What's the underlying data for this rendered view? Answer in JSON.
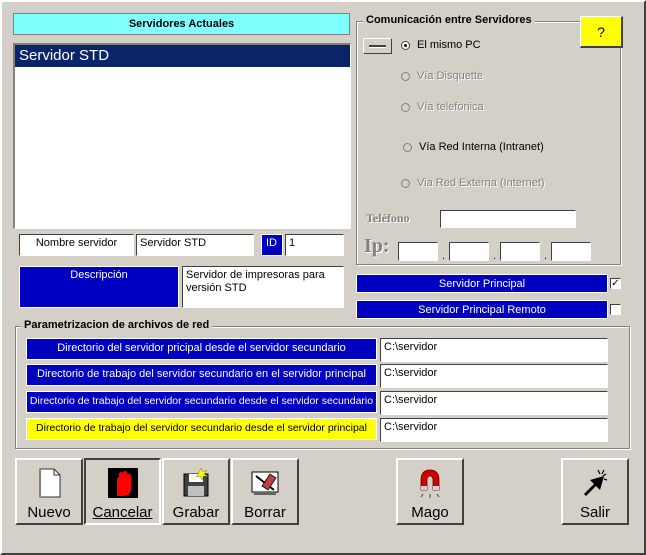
{
  "servers_panel": {
    "header": "Servidores Actuales",
    "items": [
      "Servidor STD"
    ]
  },
  "server_fields": {
    "name_label": "Nombre servidor",
    "name_value": "Servidor STD",
    "id_label": "ID",
    "id_value": "1",
    "desc_label": "Descripción",
    "desc_value": "Servidor de impresoras para versión STD"
  },
  "comms": {
    "title": "Comunicación entre Servidores",
    "help_label": "?",
    "options": [
      {
        "label": "El mismo PC",
        "selected": true,
        "enabled": true
      },
      {
        "label": "Vía Disquette",
        "selected": false,
        "enabled": false
      },
      {
        "label": "Vía telefonica",
        "selected": false,
        "enabled": false
      },
      {
        "label": "Vía Red Interna (Intranet)",
        "selected": false,
        "enabled": true
      },
      {
        "label": "Via Red Externa (Internet)",
        "selected": false,
        "enabled": false
      }
    ],
    "phone_label": "Teléfono",
    "phone_value": "",
    "ip_label": "Ip:",
    "ip_sep": ".",
    "ip_parts": [
      "",
      "",
      "",
      ""
    ]
  },
  "server_flags": {
    "principal_label": "Servidor Principal",
    "principal_checked": true,
    "remote_label": "Servidor Principal Remoto",
    "remote_checked": false
  },
  "network_params": {
    "title": "Parametrizacion de archivos de red",
    "rows": [
      {
        "label": "Directorio del servidor pricipal desde el servidor secundario",
        "value": "C:\\servidor",
        "highlight": false
      },
      {
        "label": "Directorio de trabajo del servidor secundario en el servidor principal",
        "value": "C:\\servidor",
        "highlight": false
      },
      {
        "label": "Directorio de trabajo del servidor secundario desde el servidor secundario",
        "value": "C:\\servidor",
        "highlight": false
      },
      {
        "label": "Directorio de trabajo del servidor secundario desde el servidor principal",
        "value": "C:\\servidor",
        "highlight": true
      }
    ]
  },
  "toolbar": {
    "nuevo": "Nuevo",
    "cancelar": "Cancelar",
    "grabar": "Grabar",
    "borrar": "Borrar",
    "mago": "Mago",
    "salir": "Salir"
  },
  "colors": {
    "window_bg": "#d4d0c8",
    "header_cyan": "#80ffff",
    "selection_navy": "#0a246a",
    "label_blue": "#0000c0",
    "help_yellow": "#ffff00"
  },
  "icons": {
    "nuevo": "blank-page-icon",
    "cancelar": "red-hand-icon",
    "grabar": "save-disk-icon",
    "borrar": "eraser-icon",
    "mago": "magnet-icon",
    "salir": "exit-door-icon"
  }
}
